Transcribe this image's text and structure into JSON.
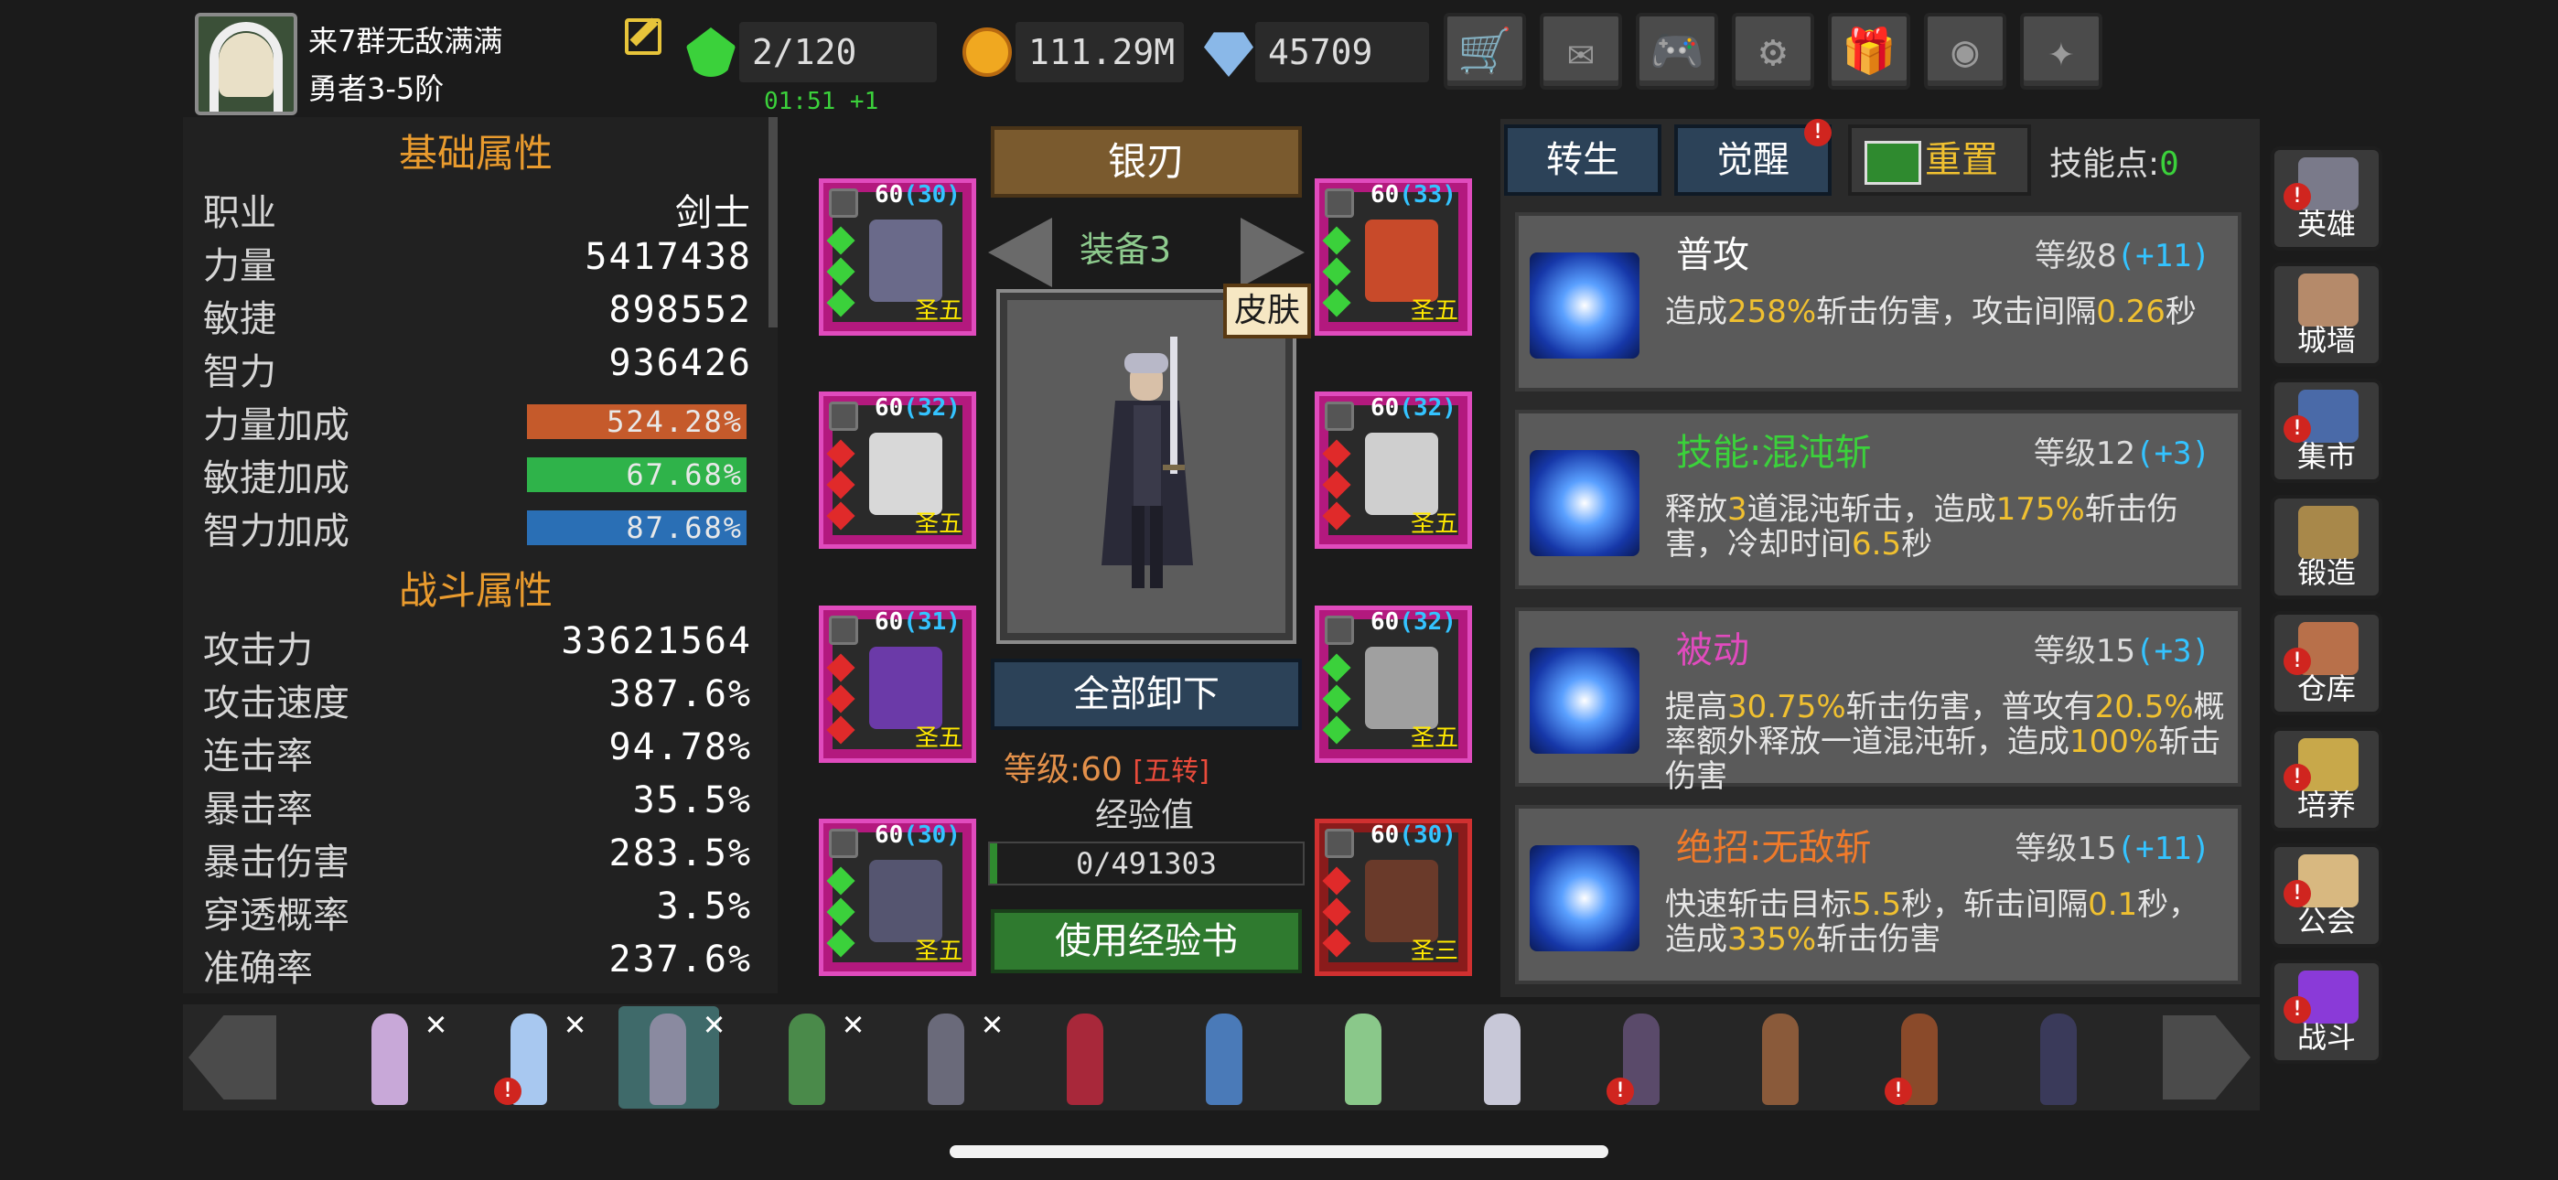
{
  "player": {
    "name": "来7群无敌满满",
    "rank": "勇者3-5阶"
  },
  "resources": {
    "stamina": "2/120",
    "stamina_timer": "01:51 +1",
    "gold": "111.29M",
    "diamonds": "45709"
  },
  "top_buttons": [
    {
      "name": "shop",
      "icon": "cart-icon",
      "glyph": "🛒"
    },
    {
      "name": "mail",
      "icon": "mail-icon",
      "glyph": "✉"
    },
    {
      "name": "game",
      "icon": "gamepad-icon",
      "glyph": "🎮"
    },
    {
      "name": "settings",
      "icon": "gear-icon",
      "glyph": "⚙"
    },
    {
      "name": "gift",
      "icon": "gift-icon",
      "glyph": "🎁"
    },
    {
      "name": "lucky-wheel",
      "icon": "wheel-icon",
      "glyph": "◉"
    },
    {
      "name": "fireworks",
      "icon": "firework-icon",
      "glyph": "✦"
    }
  ],
  "basic_attrs": {
    "title": "基础属性",
    "rows": [
      {
        "label": "职业",
        "value": "剑士"
      },
      {
        "label": "力量",
        "value": "5417438"
      },
      {
        "label": "敏捷",
        "value": "898552"
      },
      {
        "label": "智力",
        "value": "936426"
      }
    ],
    "bonus_rows": [
      {
        "label": "力量加成",
        "value": "524.28%",
        "color": "#c55a2b"
      },
      {
        "label": "敏捷加成",
        "value": "67.68%",
        "color": "#2fb34a"
      },
      {
        "label": "智力加成",
        "value": "87.68%",
        "color": "#2a6fb5"
      }
    ]
  },
  "combat_attrs": {
    "title": "战斗属性",
    "rows": [
      {
        "label": "攻击力",
        "value": "33621564"
      },
      {
        "label": "攻击速度",
        "value": "387.6%"
      },
      {
        "label": "连击率",
        "value": "94.78%"
      },
      {
        "label": "暴击率",
        "value": "35.5%"
      },
      {
        "label": "暴击伤害",
        "value": "283.5%"
      },
      {
        "label": "穿透概率",
        "value": "3.5%"
      },
      {
        "label": "准确率",
        "value": "237.6%"
      }
    ]
  },
  "equipment": {
    "weapon_name": "银刃",
    "set_label": "装备3",
    "skin_label": "皮肤",
    "unequip_all": "全部卸下",
    "level_label": "等级:60",
    "rebirth_label": "[五转]",
    "exp_label": "经验值",
    "exp_value": "0/491303",
    "use_exp_book": "使用经验书",
    "slots": [
      {
        "level": "60",
        "bonus": "(30)",
        "tag": "圣五",
        "gem": "#3bd13b",
        "item_color": "#6a6a8a"
      },
      {
        "level": "60",
        "bonus": "(33)",
        "tag": "圣五",
        "gem": "#3bd13b",
        "item_color": "#c84a2a"
      },
      {
        "level": "60",
        "bonus": "(32)",
        "tag": "圣五",
        "gem": "#e02a2a",
        "item_color": "#d8d8d8"
      },
      {
        "level": "60",
        "bonus": "(32)",
        "tag": "圣五",
        "gem": "#e02a2a",
        "item_color": "#cfcfcf"
      },
      {
        "level": "60",
        "bonus": "(31)",
        "tag": "圣五",
        "gem": "#e02a2a",
        "item_color": "#6b3aa8"
      },
      {
        "level": "60",
        "bonus": "(32)",
        "tag": "圣五",
        "gem": "#3bd13b",
        "item_color": "#a0a0a0"
      },
      {
        "level": "60",
        "bonus": "(30)",
        "tag": "圣五",
        "gem": "#3bd13b",
        "item_color": "#555570"
      },
      {
        "level": "60",
        "bonus": "(30)",
        "tag": "圣三",
        "gem": "#e02a2a",
        "item_color": "#6a3a2a"
      }
    ]
  },
  "skills_panel": {
    "tab_rebirth": "转生",
    "tab_awaken": "觉醒",
    "reset": "重置",
    "skill_points_label": "技能点:",
    "skill_points": "0",
    "skills": [
      {
        "name": "普攻",
        "name_color": "#ffffff",
        "level": "等级8",
        "bonus": "(+11)",
        "desc": [
          {
            "t": "造成"
          },
          {
            "t": "258%",
            "c": "y"
          },
          {
            "t": "斩击伤害，攻击间隔"
          },
          {
            "t": "0.26",
            "c": "y"
          },
          {
            "t": "秒"
          }
        ]
      },
      {
        "name": "技能:混沌斩",
        "name_color": "#3bd13b",
        "level": "等级12",
        "bonus": "(+3)",
        "desc": [
          {
            "t": "释放"
          },
          {
            "t": "3",
            "c": "y"
          },
          {
            "t": "道混沌斩击，造成"
          },
          {
            "t": "175%",
            "c": "y"
          },
          {
            "t": "斩击伤害，冷却时间"
          },
          {
            "t": "6.5",
            "c": "y"
          },
          {
            "t": "秒"
          }
        ]
      },
      {
        "name": "被动",
        "name_color": "#e04bbd",
        "level": "等级15",
        "bonus": "(+3)",
        "desc": [
          {
            "t": "提高"
          },
          {
            "t": "30.75%",
            "c": "y"
          },
          {
            "t": "斩击伤害，普攻有"
          },
          {
            "t": "20.5%",
            "c": "y"
          },
          {
            "t": "概率额外释放一道混沌斩，造成"
          },
          {
            "t": "100%",
            "c": "y"
          },
          {
            "t": "斩击伤害"
          }
        ]
      },
      {
        "name": "绝招:无敌斩",
        "name_color": "#f07a2a",
        "level": "等级15",
        "bonus": "(+11)",
        "desc": [
          {
            "t": "快速斩击目标"
          },
          {
            "t": "5.5",
            "c": "y"
          },
          {
            "t": "秒，斩击间隔"
          },
          {
            "t": "0.1",
            "c": "y"
          },
          {
            "t": "秒，造成"
          },
          {
            "t": "335%",
            "c": "y"
          },
          {
            "t": "斩击伤害"
          }
        ]
      }
    ]
  },
  "side_menu": [
    {
      "label": "英雄",
      "icon": "helmet-icon",
      "color": "#7a7a8a",
      "alert": true
    },
    {
      "label": "城墙",
      "icon": "wall-icon",
      "color": "#b58a6a",
      "alert": false
    },
    {
      "label": "集市",
      "icon": "market-icon",
      "color": "#4a6aa8",
      "alert": true
    },
    {
      "label": "锻造",
      "icon": "anvil-icon",
      "color": "#a8884a",
      "alert": false
    },
    {
      "label": "仓库",
      "icon": "warehouse-icon",
      "color": "#b8704a",
      "alert": true
    },
    {
      "label": "培养",
      "icon": "trophy-icon",
      "color": "#c8a84a",
      "alert": true
    },
    {
      "label": "公会",
      "icon": "guild-icon",
      "color": "#d8b880",
      "alert": true
    },
    {
      "label": "战斗",
      "icon": "portal-icon",
      "color": "#8a3ad8",
      "alert": true
    }
  ],
  "hero_bar": [
    {
      "color": "#c8a8d8",
      "removable": true,
      "alert": false,
      "selected": false
    },
    {
      "color": "#a8c8f0",
      "removable": true,
      "alert": true,
      "selected": false
    },
    {
      "color": "#8a8aa0",
      "removable": true,
      "alert": false,
      "selected": true
    },
    {
      "color": "#4a8a4a",
      "removable": true,
      "alert": false,
      "selected": false
    },
    {
      "color": "#6a6a7a",
      "removable": true,
      "alert": false,
      "selected": false
    },
    {
      "color": "#a8283a",
      "removable": false,
      "alert": false,
      "selected": false
    },
    {
      "color": "#4a7ab8",
      "removable": false,
      "alert": false,
      "selected": false
    },
    {
      "color": "#8ac88a",
      "removable": false,
      "alert": false,
      "selected": false
    },
    {
      "color": "#c8c8d8",
      "removable": false,
      "alert": false,
      "selected": false
    },
    {
      "color": "#5a4a6a",
      "removable": false,
      "alert": true,
      "selected": false
    },
    {
      "color": "#8a5a3a",
      "removable": false,
      "alert": false,
      "selected": false
    },
    {
      "color": "#8a4a2a",
      "removable": false,
      "alert": true,
      "selected": false
    },
    {
      "color": "#3a3a5a",
      "removable": false,
      "alert": false,
      "selected": false
    }
  ],
  "badge_text": "!",
  "remove_text": "✕"
}
